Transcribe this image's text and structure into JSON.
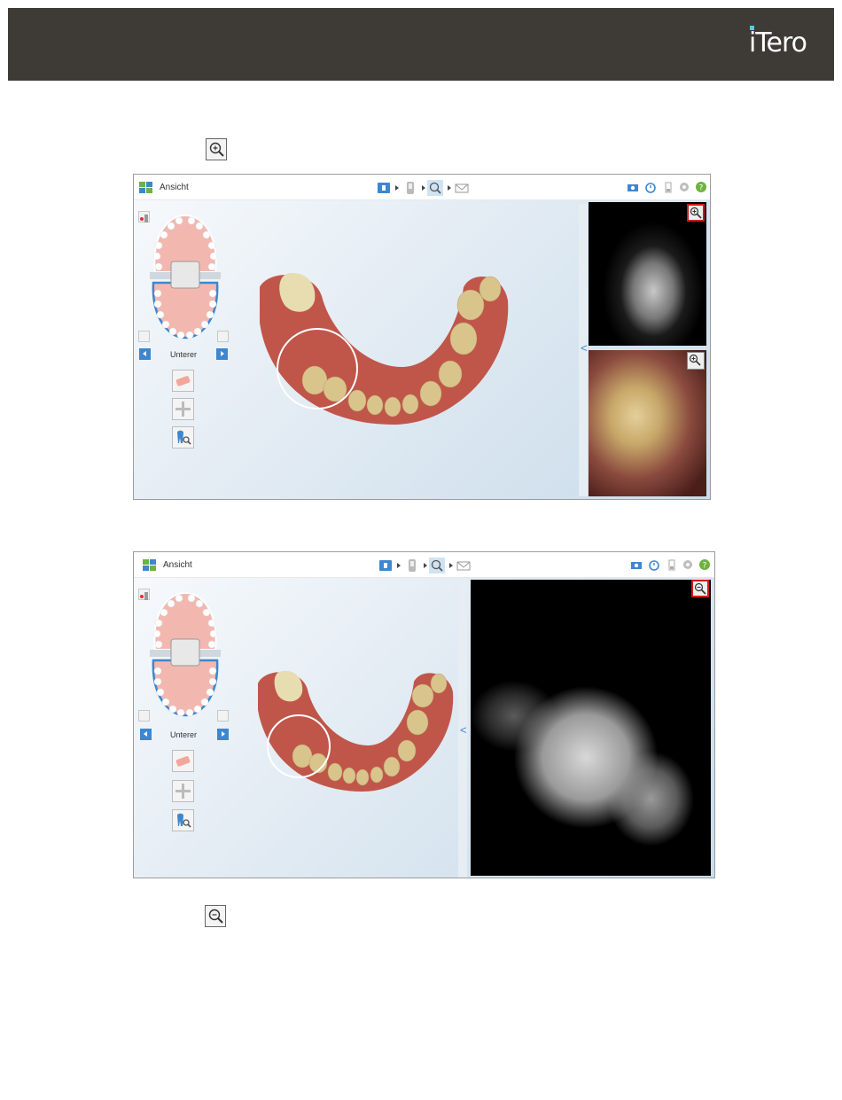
{
  "header": {
    "logo_text": "iTero",
    "bg_color": "#3e3a36",
    "logo_dot_color": "#5cc8e8"
  },
  "icons": {
    "zoom_in": "zoom-in-icon",
    "zoom_out": "zoom-out-icon"
  },
  "screenshot_1": {
    "view_title": "Ansicht",
    "arch_label": "Unterer",
    "workflow_steps": [
      "patient-icon",
      "scan-icon",
      "view-icon",
      "send-icon"
    ],
    "toolbar_tools": [
      "camera-icon",
      "timer-icon",
      "battery-icon",
      "settings-icon",
      "help-icon"
    ],
    "image_panels": [
      "nir-image",
      "color-image"
    ]
  },
  "screenshot_2": {
    "view_title": "Ansicht",
    "arch_label": "Unterer",
    "workflow_steps": [
      "patient-icon",
      "scan-icon",
      "view-icon",
      "send-icon"
    ],
    "toolbar_tools": [
      "camera-icon",
      "timer-icon",
      "battery-icon",
      "settings-icon",
      "help-icon"
    ],
    "image_panels": [
      "nir-image-enlarged"
    ]
  },
  "colors": {
    "accent_blue": "#3d87d0",
    "highlight_red": "#d11a1a",
    "help_green": "#6cb33f"
  }
}
